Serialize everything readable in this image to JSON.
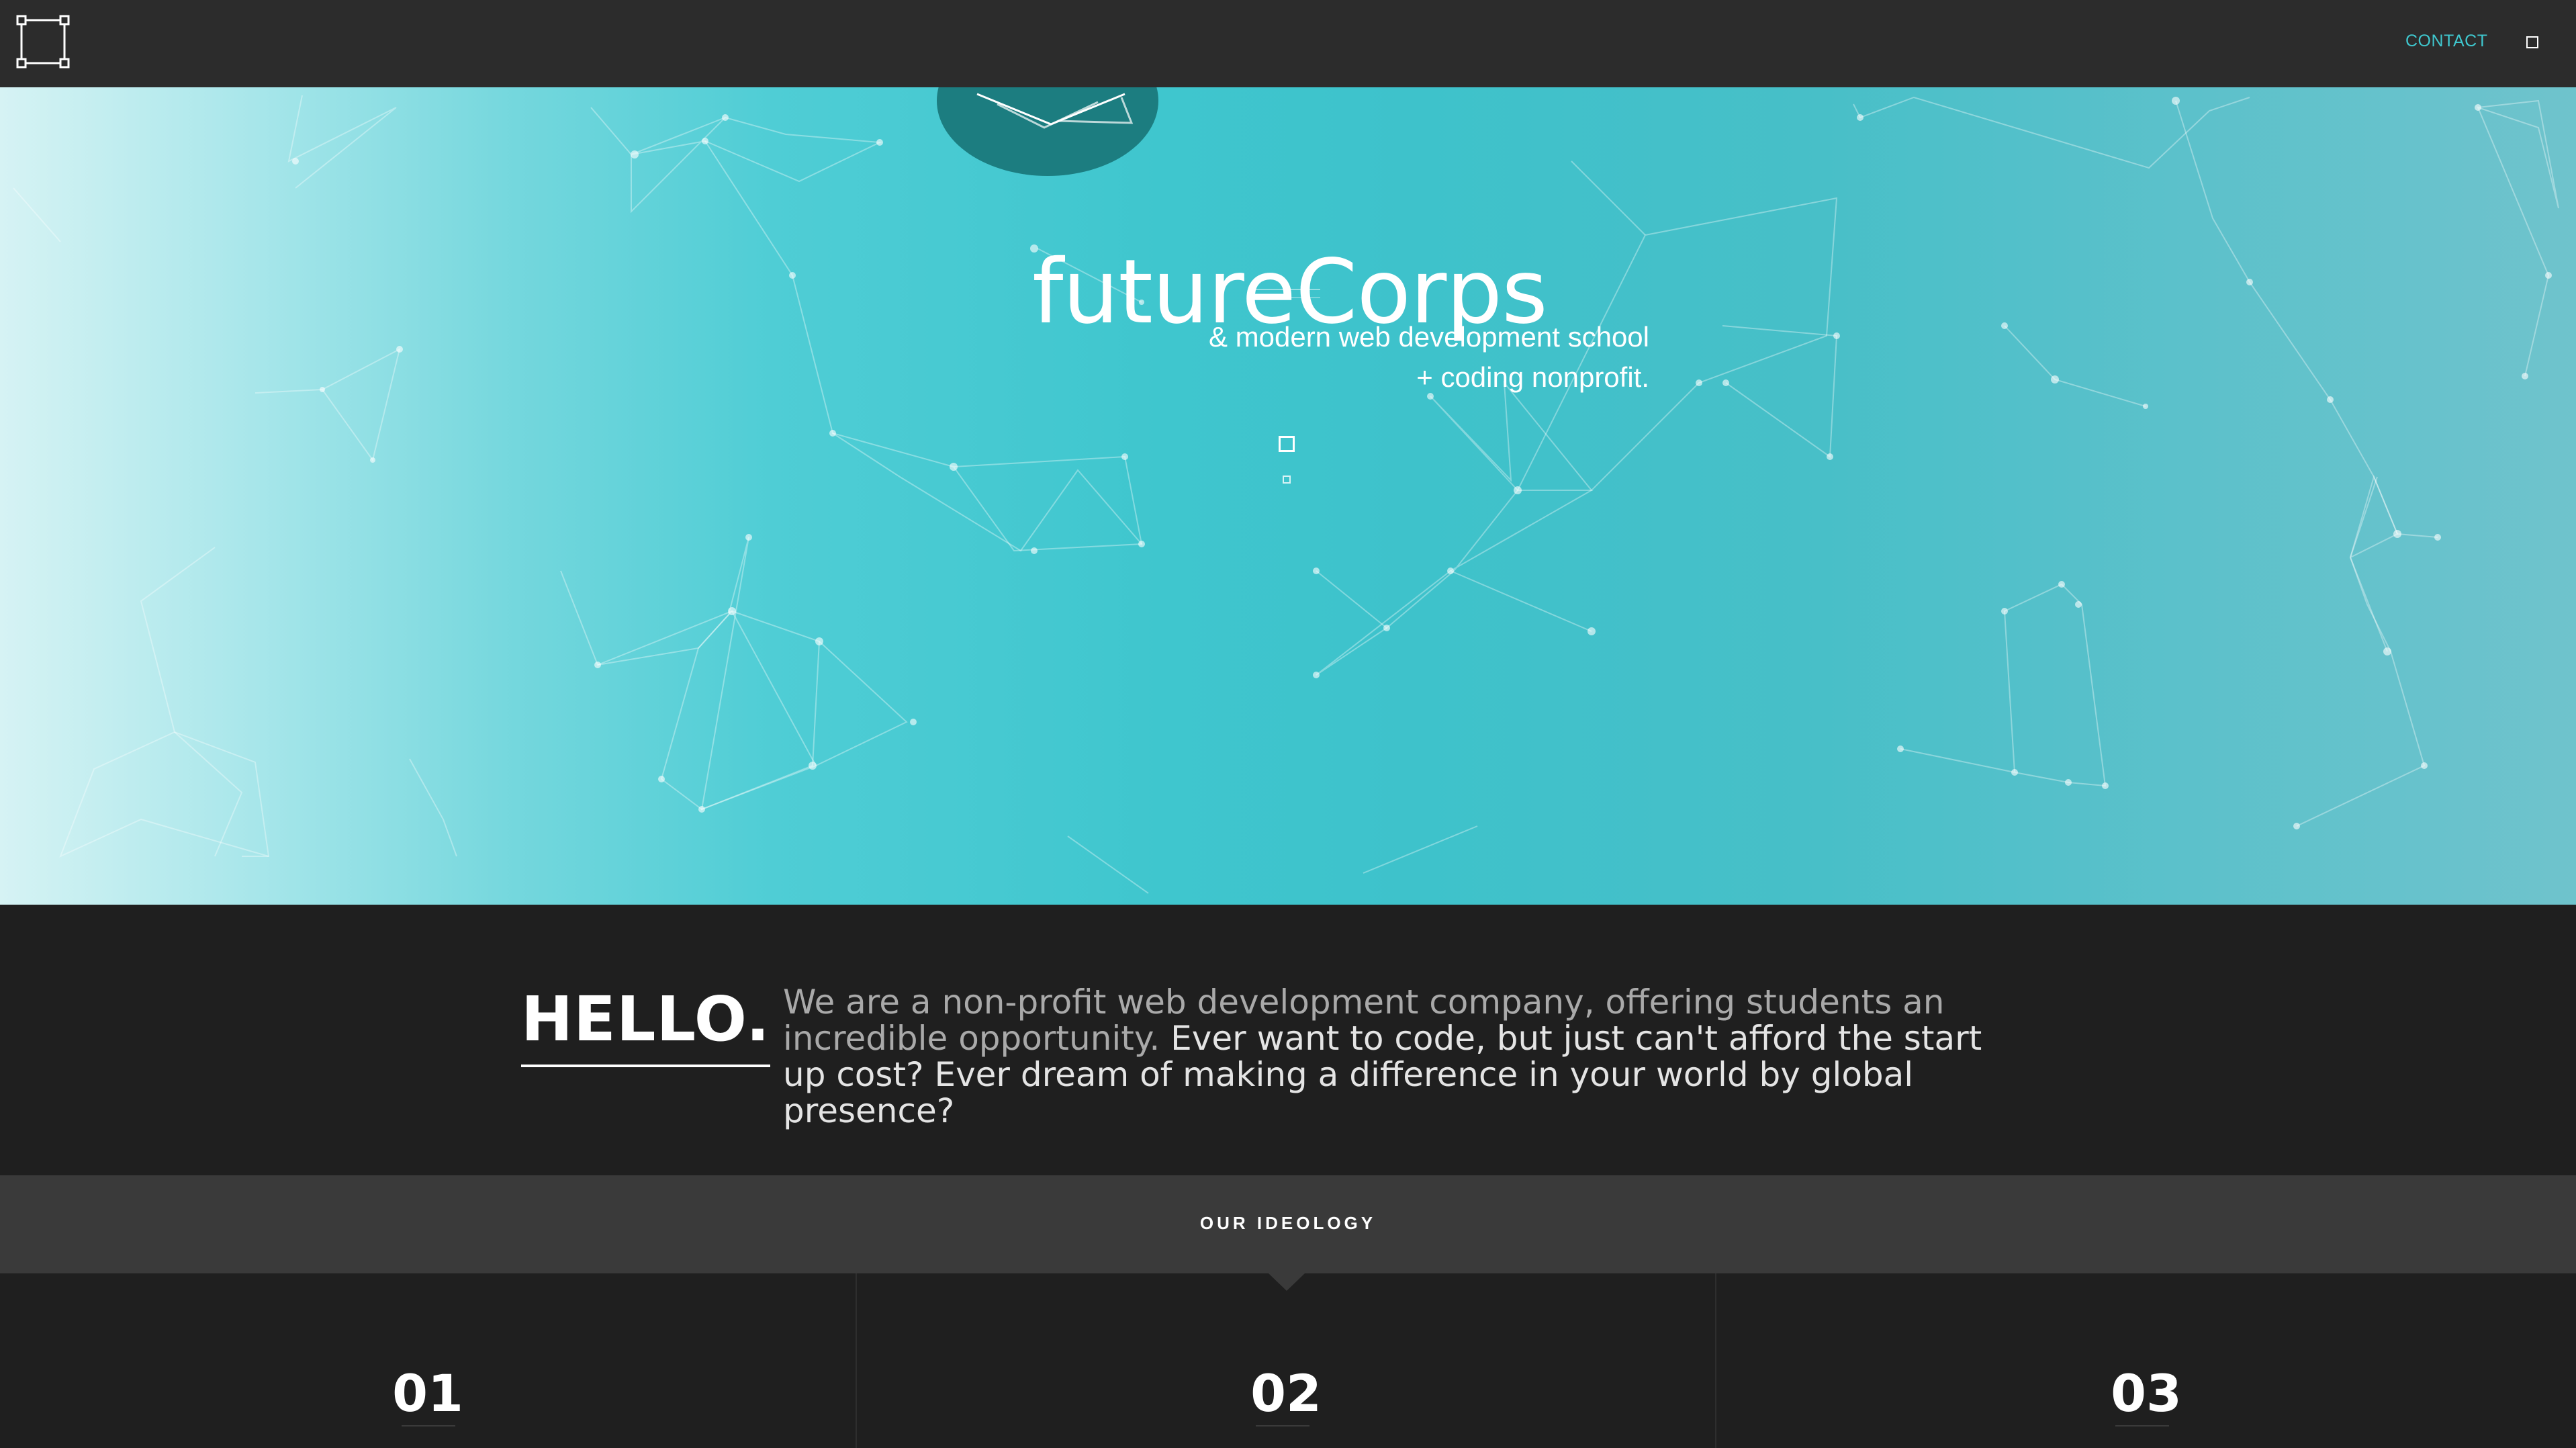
{
  "nav": {
    "contact_label": "CONTACT"
  },
  "hero": {
    "title": "futureCorps",
    "tagline_line1": "& modern web development school",
    "tagline_line2": "+ coding nonprofit."
  },
  "hello": {
    "heading": "HELLO.",
    "text_muted": "We are a non-profit web development company, offering students an incredible opportunity.",
    "text_bright": "Ever want to code, but just can't afford the start up cost? Ever dream of making a difference in your world by global presence?"
  },
  "ideology": {
    "title": "OUR IDEOLOGY",
    "columns": [
      {
        "number": "01"
      },
      {
        "number": "02"
      },
      {
        "number": "03"
      }
    ]
  },
  "colors": {
    "accent": "#3fc8cf",
    "nav_bg": "#2c2c2c",
    "dark_bg": "#1f1f1f",
    "section_bar": "#3a3a3a"
  }
}
